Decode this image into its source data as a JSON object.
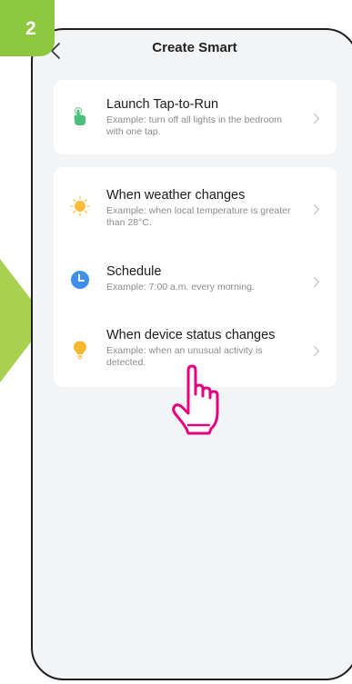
{
  "step_badge": {
    "number": "2",
    "color": "#8dc63f"
  },
  "header": {
    "title": "Create Smart",
    "back_icon": "chevron-left-icon"
  },
  "cards": [
    {
      "items": [
        {
          "title": "Launch Tap-to-Run",
          "subtitle": "Example: turn off all lights in the bedroom with one tap.",
          "icon": "tap-hand-icon",
          "icon_color": "#4cc07a"
        }
      ]
    },
    {
      "items": [
        {
          "title": "When weather changes",
          "subtitle": "Example: when local temperature is greater than 28°C.",
          "icon": "sun-icon",
          "icon_color": "#ffb93a"
        },
        {
          "title": "Schedule",
          "subtitle": "Example: 7:00 a.m. every morning.",
          "icon": "clock-icon",
          "icon_color": "#3d8fe8"
        },
        {
          "title": "When device status changes",
          "subtitle": "Example: when an unusual activity is detected.",
          "icon": "lightbulb-icon",
          "icon_color": "#f7b731"
        }
      ]
    }
  ],
  "annotation": {
    "pointer_icon": "pointing-hand-icon",
    "pointer_color": "#e6007e",
    "arrow_color": "#8dc63f"
  }
}
